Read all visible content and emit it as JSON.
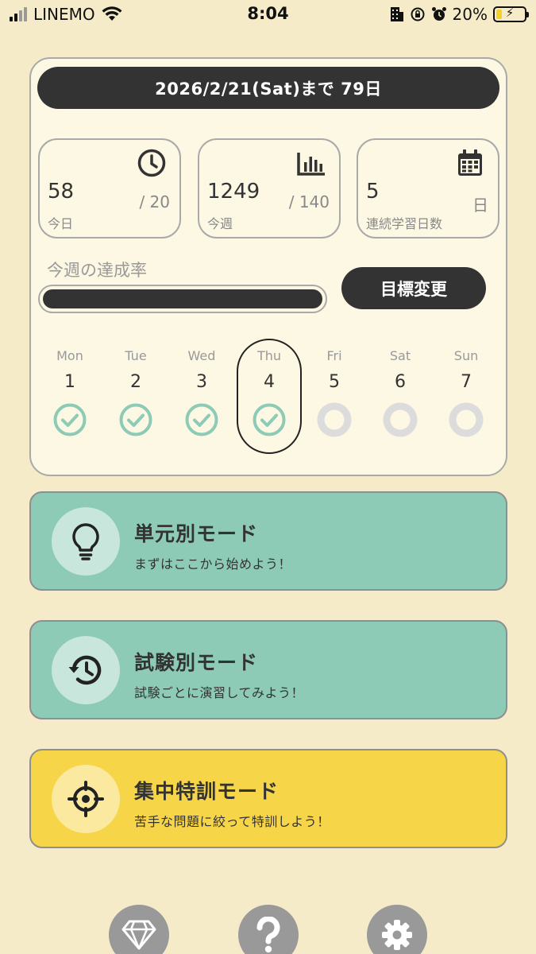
{
  "status_bar": {
    "carrier": "LINEMO",
    "time": "8:04",
    "battery_percent": "20%",
    "battery_level": 0.2
  },
  "countdown": {
    "text": "2026/2/21(Sat)まで 79日"
  },
  "stats": [
    {
      "value": "58",
      "target": "/ 20",
      "label": "今日",
      "icon": "clock-icon"
    },
    {
      "value": "1249",
      "target": "/ 140",
      "label": "今週",
      "icon": "bar-chart-icon"
    },
    {
      "value": "5",
      "target": "日",
      "label": "連続学習日数",
      "icon": "calendar-icon"
    }
  ],
  "weekly_rate": {
    "label": "今週の達成率",
    "fraction": 1.0
  },
  "goal_button": {
    "label": "目標変更"
  },
  "week": [
    {
      "name": "Mon",
      "num": "1",
      "done": true
    },
    {
      "name": "Tue",
      "num": "2",
      "done": true
    },
    {
      "name": "Wed",
      "num": "3",
      "done": true
    },
    {
      "name": "Thu",
      "num": "4",
      "done": true,
      "today": true
    },
    {
      "name": "Fri",
      "num": "5",
      "done": false
    },
    {
      "name": "Sat",
      "num": "6",
      "done": false
    },
    {
      "name": "Sun",
      "num": "7",
      "done": false
    }
  ],
  "modes": [
    {
      "title": "単元別モード",
      "subtitle": "まずはここから始めよう！",
      "icon": "lightbulb-icon",
      "color": "#8dcbb7",
      "icon_bg": "#c8e6dc"
    },
    {
      "title": "試験別モード",
      "subtitle": "試験ごとに演習してみよう！",
      "icon": "history-icon",
      "color": "#8dcbb7",
      "icon_bg": "#c8e6dc"
    },
    {
      "title": "集中特訓モード",
      "subtitle": "苦手な問題に絞って特訓しよう！",
      "icon": "crosshair-icon",
      "color": "#f7d548",
      "icon_bg": "#fbe9a0"
    }
  ],
  "bottom_nav": [
    {
      "icon": "diamond-icon"
    },
    {
      "icon": "help-icon"
    },
    {
      "icon": "gear-icon"
    }
  ],
  "colors": {
    "background": "#f6ebc9",
    "card": "#fdf8e3",
    "dark": "#333333",
    "check": "#8dcbb7",
    "pending": "#dcdcdc"
  }
}
